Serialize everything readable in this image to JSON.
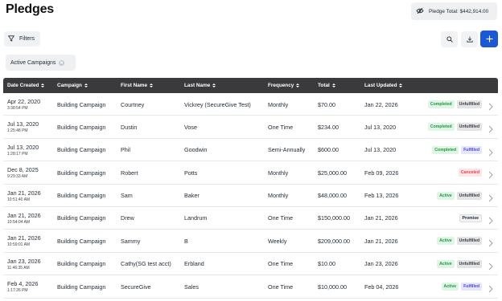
{
  "header": {
    "title": "Pledges",
    "pledge_total": "Pledge Total: $442,914.00"
  },
  "toolbar": {
    "filters_label": "Filters",
    "active_filter": "Active Campaigns"
  },
  "colors": {
    "accent": "#1b58d4",
    "header_bg": "#3a3a3c",
    "completed_bg": "#dff5e6",
    "completed_fg": "#23963f",
    "active_bg": "#dff5e6",
    "active_fg": "#23963f",
    "unfulfilled_bg": "#e3e4e6",
    "unfulfilled_fg": "#3a3d42",
    "fulfilled_bg": "#e6e6fb",
    "fulfilled_fg": "#4c48d8",
    "canceled_bg": "#fde4e6",
    "canceled_fg": "#e0454f",
    "promise_bg": "#f2f3f5",
    "promise_fg": "#1f2933"
  },
  "table": {
    "columns": [
      "Date Created",
      "Campaign",
      "First Name",
      "Last Name",
      "Frequency",
      "Total",
      "Last Updated"
    ],
    "rows": [
      {
        "date": "Apr 22, 2020",
        "time": "3:38:54 PM",
        "campaign": "Building Campaign",
        "first": "Courtney",
        "last": "Vickrey (SecureGive Test)",
        "frequency": "Monthly",
        "total": "$70.00",
        "updated": "Jan 22, 2026",
        "badges": [
          "Completed",
          "Unfulfilled"
        ]
      },
      {
        "date": "Jul 13, 2020",
        "time": "1:25:48 PM",
        "campaign": "Building Campaign",
        "first": "Dustin",
        "last": "Vose",
        "frequency": "One Time",
        "total": "$234.00",
        "updated": "Jul 13, 2020",
        "badges": [
          "Completed",
          "Unfulfilled"
        ]
      },
      {
        "date": "Jul 13, 2020",
        "time": "1:28:17 PM",
        "campaign": "Building Campaign",
        "first": "Phil",
        "last": "Goodwin",
        "frequency": "Semi-Annually",
        "total": "$600.00",
        "updated": "Jul 13, 2020",
        "badges": [
          "Completed",
          "Fulfilled"
        ]
      },
      {
        "date": "Dec 8, 2025",
        "time": "9:29:33 AM",
        "campaign": "Building Campaign",
        "first": "Robert",
        "last": "Potts",
        "frequency": "Monthly",
        "total": "$25,000.00",
        "updated": "Feb 09, 2026",
        "badges": [
          "Canceled"
        ]
      },
      {
        "date": "Jan 21, 2026",
        "time": "10:51:40 AM",
        "campaign": "Building Campaign",
        "first": "Sam",
        "last": "Baker",
        "frequency": "Monthly",
        "total": "$48,000.00",
        "updated": "Feb 13, 2026",
        "badges": [
          "Active",
          "Unfulfilled"
        ]
      },
      {
        "date": "Jan 21, 2026",
        "time": "10:54:04 AM",
        "campaign": "Building Campaign",
        "first": "Drew",
        "last": "Landrum",
        "frequency": "One Time",
        "total": "$150,000.00",
        "updated": "Jan 21, 2026",
        "badges": [
          "Promise"
        ]
      },
      {
        "date": "Jan 21, 2026",
        "time": "10:59:01 AM",
        "campaign": "Building Campaign",
        "first": "Sammy",
        "last": "B",
        "frequency": "Weekly",
        "total": "$209,000.00",
        "updated": "Jan 21, 2026",
        "badges": [
          "Active",
          "Unfulfilled"
        ]
      },
      {
        "date": "Jan 23, 2026",
        "time": "11:46:35 AM",
        "campaign": "Building Campaign",
        "first": "Cathy(SG test acct)",
        "last": "Erbland",
        "frequency": "One Time",
        "total": "$10.00",
        "updated": "Jan 23, 2026",
        "badges": [
          "Active",
          "Unfulfilled"
        ]
      },
      {
        "date": "Feb 4, 2026",
        "time": "1:17:26 PM",
        "campaign": "Building Campaign",
        "first": "SecureGive",
        "last": "Sales",
        "frequency": "One Time",
        "total": "$10,000.00",
        "updated": "Feb 04, 2026",
        "badges": [
          "Active",
          "Fulfilled"
        ]
      }
    ]
  }
}
